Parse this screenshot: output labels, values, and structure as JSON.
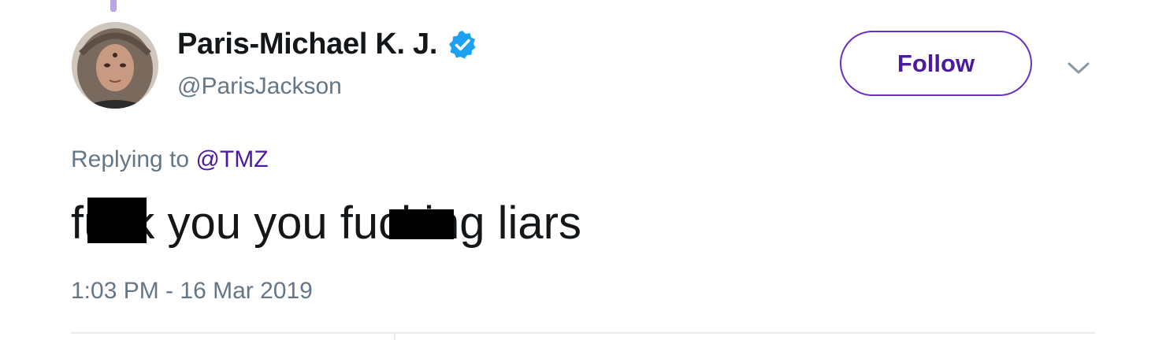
{
  "author": {
    "display_name": "Paris-Michael K. J.",
    "handle": "@ParisJackson",
    "verified": true,
    "verified_icon": "verified-badge-icon",
    "avatar": "profile-photo"
  },
  "actions": {
    "follow_label": "Follow",
    "more_icon": "chevron-down-icon"
  },
  "reply": {
    "prefix": "Replying to",
    "to_handle": "@TMZ"
  },
  "tweet": {
    "text": "fuck you you fucking liars",
    "redacted": true
  },
  "timestamp": "1:03 PM - 16 Mar 2019",
  "colors": {
    "accent": "#6b2fc1",
    "accent_text": "#4b1aa0",
    "muted_text": "#657786",
    "verified_blue": "#1da1f2",
    "thread_line": "#b9a6e3"
  }
}
